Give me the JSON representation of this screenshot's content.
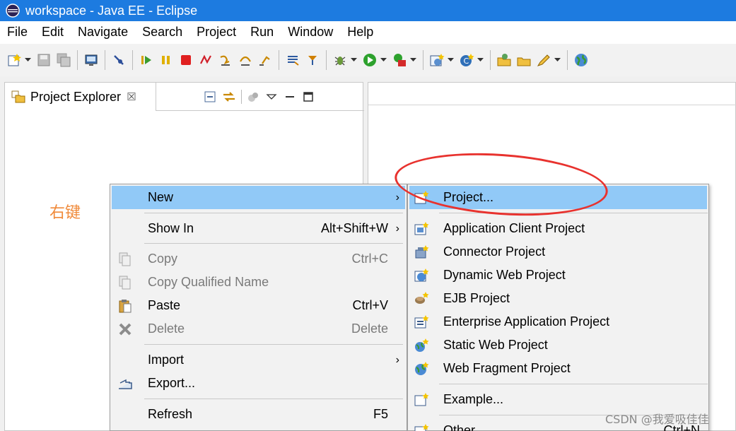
{
  "window": {
    "title": "workspace - Java EE - Eclipse"
  },
  "menubar": {
    "items": [
      "File",
      "Edit",
      "Navigate",
      "Search",
      "Project",
      "Run",
      "Window",
      "Help"
    ]
  },
  "view": {
    "tab_label": "Project Explorer",
    "close_glyph": "☒"
  },
  "annotation": "右键",
  "context_menu": {
    "new": {
      "label": "New",
      "arrow": "›"
    },
    "show_in": {
      "label": "Show In",
      "accel": "Alt+Shift+W",
      "arrow": "›"
    },
    "copy": {
      "label": "Copy",
      "accel": "Ctrl+C"
    },
    "copy_qualified": {
      "label": "Copy Qualified Name"
    },
    "paste": {
      "label": "Paste",
      "accel": "Ctrl+V"
    },
    "delete": {
      "label": "Delete",
      "accel": "Delete"
    },
    "import": {
      "label": "Import",
      "arrow": "›"
    },
    "export": {
      "label": "Export..."
    },
    "refresh": {
      "label": "Refresh",
      "accel": "F5"
    }
  },
  "submenu": {
    "project": "Project...",
    "app_client": "Application Client Project",
    "connector": "Connector Project",
    "dynamic_web": "Dynamic Web Project",
    "ejb": "EJB Project",
    "enterprise_app": "Enterprise Application Project",
    "static_web": "Static Web Project",
    "web_fragment": "Web Fragment Project",
    "example": "Example...",
    "other": "Other...",
    "other_accel": "Ctrl+N"
  },
  "watermark": "CSDN @我爱吸佳佳",
  "colors": {
    "title_bar": "#1d7be0",
    "highlight": "#91c9f7",
    "annotation": "#f08a3a",
    "circle": "#e8322e"
  }
}
